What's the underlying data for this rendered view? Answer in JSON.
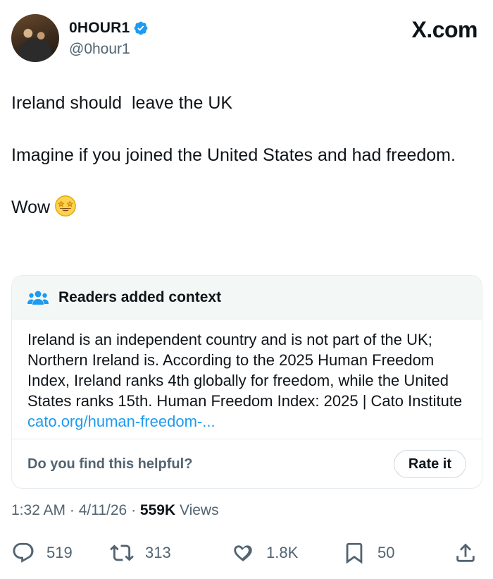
{
  "author": {
    "display_name": "0HOUR1",
    "handle": "@0hour1",
    "verified_icon": "verified-badge-icon"
  },
  "brand": "X.com",
  "tweet": {
    "line1": "Ireland should  leave the UK",
    "line2": "Imagine if you joined the United States and had freedom.",
    "line3": "Wow",
    "emoji": "star-struck-emoji"
  },
  "community_note": {
    "title": "Readers added context",
    "body": "Ireland is an independent country and is not part of the UK; Northern Ireland is. According to the 2025 Human Freedom Index, Ireland ranks 4th globally for freedom, while the United States ranks 15th. Human Freedom Index: 2025 | Cato Institute ",
    "link_text": "cato.org/human-freedom-...",
    "helpful_question": "Do you find this helpful?",
    "rate_label": "Rate it"
  },
  "meta": {
    "time": "1:32 AM",
    "sep1": " · ",
    "date": "4/11/26",
    "sep2": " · ",
    "views_count": "559K",
    "views_label": " Views"
  },
  "actions": {
    "replies": "519",
    "reposts": "313",
    "likes": "1.8K",
    "bookmarks": "50"
  },
  "colors": {
    "accent": "#1d9bf0",
    "secondary_text": "#536471",
    "note_header_bg": "#f3f8f7"
  }
}
